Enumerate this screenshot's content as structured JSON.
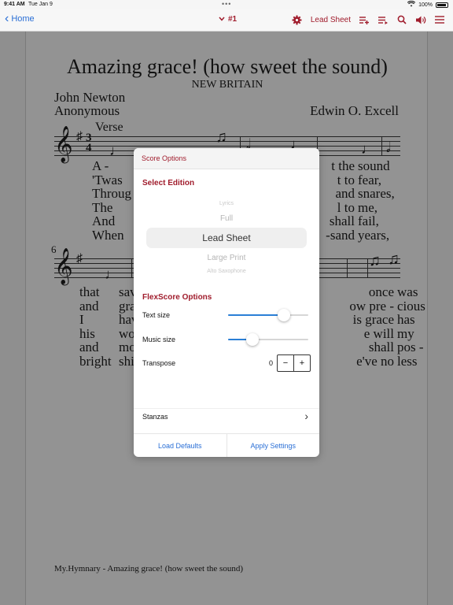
{
  "status": {
    "time": "9:41 AM",
    "date": "Tue Jan 9",
    "battery": "100%"
  },
  "nav": {
    "back_label": "Home",
    "center_label": "#1",
    "edition_label": "Lead Sheet"
  },
  "score": {
    "title": "Amazing grace! (how sweet the sound)",
    "tune": "NEW BRITAIN",
    "author1": "John Newton",
    "author2": "Anonymous",
    "composer": "Edwin O. Excell",
    "verse_label": "Verse",
    "measure_number": "6",
    "lyrics1_left": [
      "A -",
      "'Twas",
      "Throug",
      "The",
      "And",
      "When"
    ],
    "lyrics1_right_a": [
      "t the",
      "t to",
      "and",
      "l to",
      "shall",
      "-sand"
    ],
    "lyrics1_right_b": [
      "sound",
      "fear,",
      "snares,",
      "me,",
      "fail,",
      "years,"
    ],
    "lyrics2_left": [
      "that",
      "and",
      "I",
      "his",
      "and",
      "bright"
    ],
    "lyrics2_left_b": [
      "sav",
      "gra",
      "hav",
      "wo",
      "mo",
      "shi"
    ],
    "lyrics2_right_a": [
      "once",
      "ow pre -",
      "is grace",
      "e will",
      "shall",
      "e've no"
    ],
    "lyrics2_right_b": [
      "was",
      "cious",
      "has",
      "my",
      "pos -",
      "less"
    ],
    "footer": "My.Hymnary - Amazing grace! (how sweet the sound)"
  },
  "popover": {
    "header": "Score Options",
    "edition_title": "Select Edition",
    "editions": [
      "Lyrics",
      "Full",
      "Lead Sheet",
      "Large Print",
      "Alto Saxophone"
    ],
    "selected_edition": "Lead Sheet",
    "flex_title": "FlexScore Options",
    "text_size_label": "Text size",
    "text_size_value": 0.7,
    "music_size_label": "Music size",
    "music_size_value": 0.3,
    "transpose_label": "Transpose",
    "transpose_value": "0",
    "minus_label": "−",
    "plus_label": "+",
    "stanzas_label": "Stanzas",
    "load_defaults_label": "Load Defaults",
    "apply_settings_label": "Apply Settings"
  },
  "colors": {
    "accent": "#a01c2c",
    "link": "#2a6fd6",
    "slider": "#2a7fd6"
  }
}
